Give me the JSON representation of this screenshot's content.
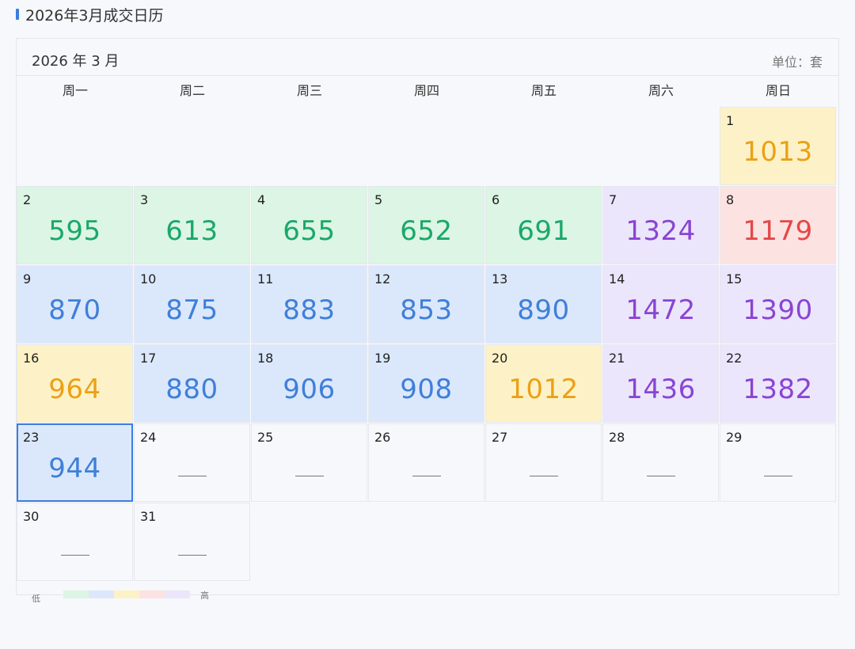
{
  "page": {
    "title": "2026年3月成交日历"
  },
  "calendar": {
    "month_label": "2026 年 3 月",
    "unit_label": "单位：套",
    "weekdays": [
      "周一",
      "周二",
      "周三",
      "周四",
      "周五",
      "周六",
      "周日"
    ],
    "leading_blanks": 6,
    "selected_day": 23,
    "days": [
      {
        "day": "1",
        "value": "1013",
        "level": "yellow"
      },
      {
        "day": "2",
        "value": "595",
        "level": "green"
      },
      {
        "day": "3",
        "value": "613",
        "level": "green"
      },
      {
        "day": "4",
        "value": "655",
        "level": "green"
      },
      {
        "day": "5",
        "value": "652",
        "level": "green"
      },
      {
        "day": "6",
        "value": "691",
        "level": "green"
      },
      {
        "day": "7",
        "value": "1324",
        "level": "purple"
      },
      {
        "day": "8",
        "value": "1179",
        "level": "red"
      },
      {
        "day": "9",
        "value": "870",
        "level": "blue"
      },
      {
        "day": "10",
        "value": "875",
        "level": "blue"
      },
      {
        "day": "11",
        "value": "883",
        "level": "blue"
      },
      {
        "day": "12",
        "value": "853",
        "level": "blue"
      },
      {
        "day": "13",
        "value": "890",
        "level": "blue"
      },
      {
        "day": "14",
        "value": "1472",
        "level": "purple"
      },
      {
        "day": "15",
        "value": "1390",
        "level": "purple"
      },
      {
        "day": "16",
        "value": "964",
        "level": "yellow"
      },
      {
        "day": "17",
        "value": "880",
        "level": "blue"
      },
      {
        "day": "18",
        "value": "906",
        "level": "blue"
      },
      {
        "day": "19",
        "value": "908",
        "level": "blue"
      },
      {
        "day": "20",
        "value": "1012",
        "level": "yellow"
      },
      {
        "day": "21",
        "value": "1436",
        "level": "purple"
      },
      {
        "day": "22",
        "value": "1382",
        "level": "purple"
      },
      {
        "day": "23",
        "value": "944",
        "level": "blue"
      },
      {
        "day": "24",
        "value": null,
        "level": "none"
      },
      {
        "day": "25",
        "value": null,
        "level": "none"
      },
      {
        "day": "26",
        "value": null,
        "level": "none"
      },
      {
        "day": "27",
        "value": null,
        "level": "none"
      },
      {
        "day": "28",
        "value": null,
        "level": "none"
      },
      {
        "day": "29",
        "value": null,
        "level": "none"
      },
      {
        "day": "30",
        "value": null,
        "level": "none"
      },
      {
        "day": "31",
        "value": null,
        "level": "none"
      }
    ]
  },
  "legend": {
    "low_label": "低",
    "high_label": "高",
    "colors": [
      "#dcf5e4",
      "#dbe8fb",
      "#fdf2c7",
      "#fde2e2",
      "#ebe6fb"
    ]
  },
  "colors": {
    "accent": "#3b7ddd",
    "green": "#1aa86a",
    "blue": "#3f7fd9",
    "yellow": "#eca016",
    "purple": "#8a44d4",
    "red": "#e34848"
  }
}
